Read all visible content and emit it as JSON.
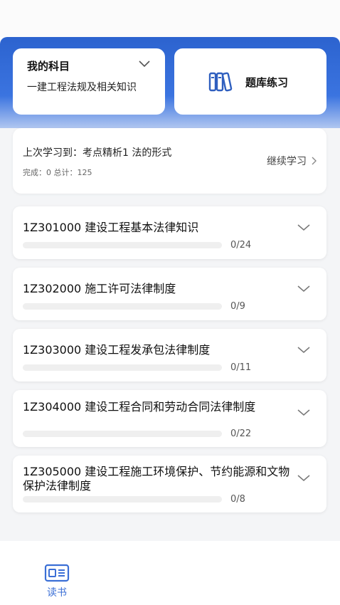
{
  "subject": {
    "title": "我的科目",
    "name": "一建工程法规及相关知识"
  },
  "question_bank": {
    "label": "题库练习"
  },
  "progress": {
    "last_study": "上次学习到：考点精析1 法的形式",
    "completed": "完成：0 总计：125",
    "continue_label": "继续学习"
  },
  "chapters": [
    {
      "title": "1Z301000 建设工程基本法律知识",
      "count": "0/24",
      "progress": 0
    },
    {
      "title": "1Z302000 施工许可法律制度",
      "count": "0/9",
      "progress": 0
    },
    {
      "title": "1Z303000 建设工程发承包法律制度",
      "count": "0/11",
      "progress": 0
    },
    {
      "title": "1Z304000 建设工程合同和劳动合同法律制度",
      "count": "0/22",
      "progress": 0
    },
    {
      "title": "1Z305000 建设工程施工环境保护、节约能源和文物保护法律制度",
      "count": "0/8",
      "progress": 0
    }
  ],
  "bottom_nav": {
    "items": [
      {
        "label": "读书",
        "icon": "book-reader-icon",
        "active": true
      }
    ]
  },
  "colors": {
    "accent": "#3b6fd6",
    "header_blue": "#2c63cf"
  }
}
